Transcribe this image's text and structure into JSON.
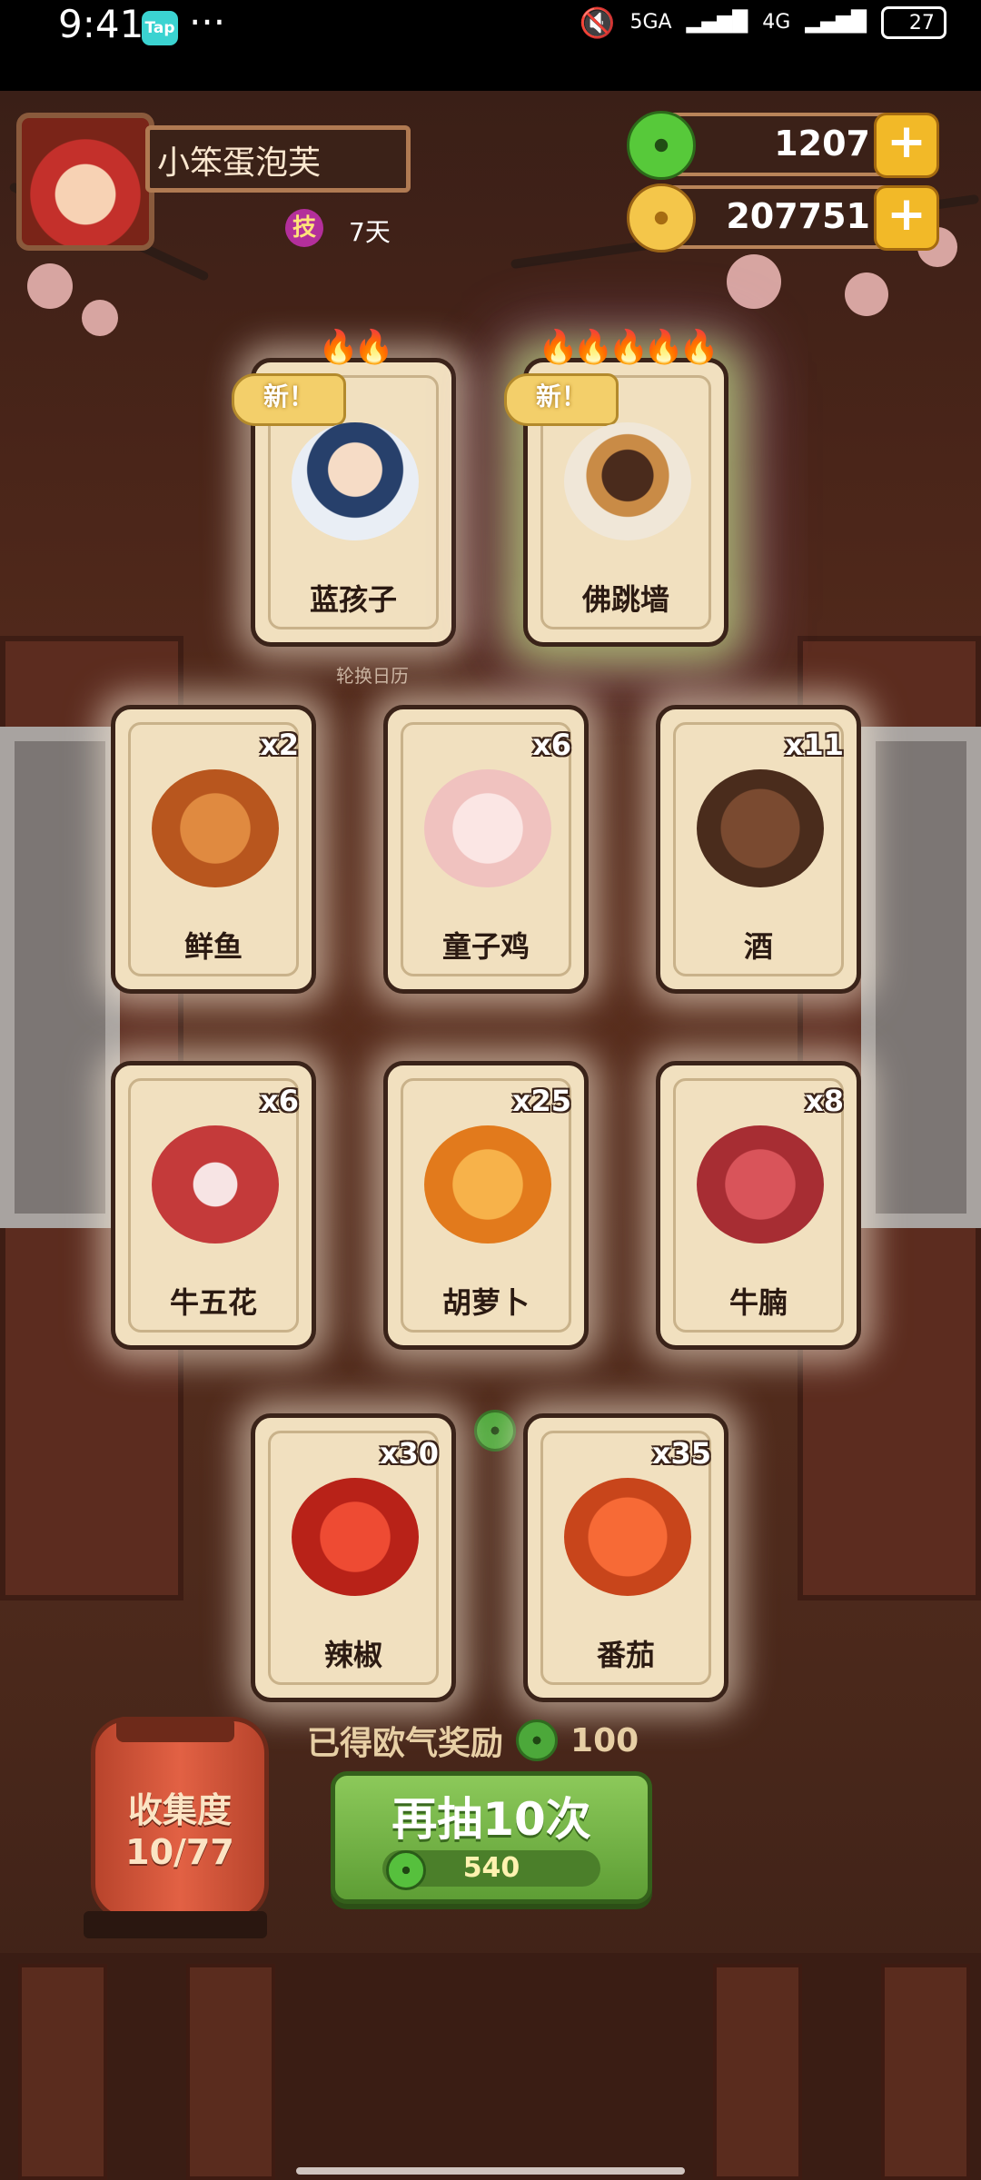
{
  "status_bar": {
    "time": "9:41",
    "app_badge": "Tap",
    "dots": "···",
    "network": "5GA",
    "network2": "4G",
    "battery": "27",
    "battery_level": 0.27
  },
  "player": {
    "name": "小笨蛋泡芙",
    "skill_badge": "技",
    "skill_days": "7天"
  },
  "currency": {
    "jade": "1207",
    "coins": "207751",
    "add_symbol": "+"
  },
  "featured_cards": [
    {
      "name": "蓝孩子",
      "new_label": "新！",
      "flames": "🔥🔥"
    },
    {
      "name": "佛跳墙",
      "new_label": "新！",
      "flames": "🔥🔥🔥🔥🔥"
    }
  ],
  "calendar_label": "轮换日历",
  "cards": [
    {
      "name": "鲜鱼",
      "qty": "x2"
    },
    {
      "name": "童子鸡",
      "qty": "x6"
    },
    {
      "name": "酒",
      "qty": "x11"
    },
    {
      "name": "牛五花",
      "qty": "x6"
    },
    {
      "name": "胡萝卜",
      "qty": "x25"
    },
    {
      "name": "牛腩",
      "qty": "x8"
    },
    {
      "name": "辣椒",
      "qty": "x30"
    },
    {
      "name": "番茄",
      "qty": "x35"
    }
  ],
  "collection": {
    "label": "收集度",
    "progress": "10/77"
  },
  "reward": {
    "label": "已得欧气奖励",
    "value": "100"
  },
  "draw_button": {
    "label": "再抽10次",
    "cost": "540"
  },
  "colors": {
    "accent_green": "#5e9e35",
    "gold": "#f2b928",
    "card_bg": "#f1e0bf"
  }
}
